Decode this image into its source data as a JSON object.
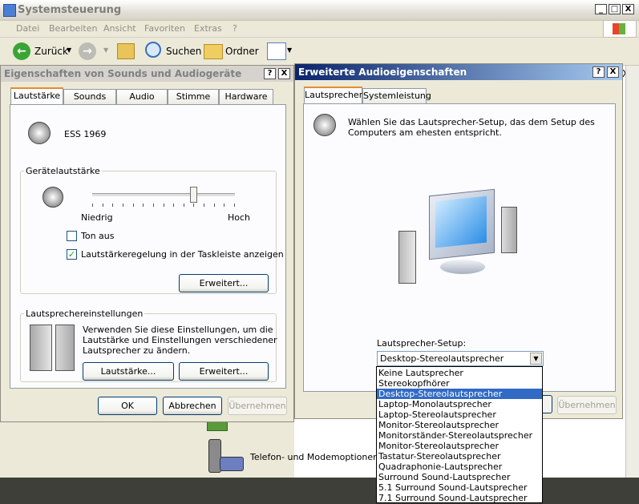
{
  "explorer": {
    "title": "Systemsteuerung",
    "menu": [
      "Datei",
      "Bearbeiten",
      "Ansicht",
      "Favoriten",
      "Extras",
      "?"
    ],
    "toolbar": {
      "back": "Zurück",
      "search": "Suchen",
      "folders": "Ordner"
    },
    "item_phone_modem": "Telefon- und Modemoptionen",
    "caption_buttons": {
      "minimize": "_",
      "maximize": "□",
      "close": "X"
    }
  },
  "sound_dialog": {
    "title": "Eigenschaften von Sounds und Audiogeräte",
    "help": "?",
    "close": "X",
    "tabs": [
      "Lautstärke",
      "Sounds",
      "Audio",
      "Stimme",
      "Hardware"
    ],
    "device_name": "ESS 1969",
    "volume_group": "Gerätelautstärke",
    "volume_low": "Niedrig",
    "volume_high": "Hoch",
    "volume_level": 0.72,
    "mute_label": "Ton aus",
    "mute_checked": false,
    "taskbar_label": "Lautstärkeregelung in der Taskleiste anzeigen",
    "taskbar_checked": true,
    "advanced_button": "Erweitert...",
    "speaker_group": "Lautsprechereinstellungen",
    "speaker_text": [
      "Verwenden Sie diese Einstellungen, um die",
      "Lautstärke und Einstellungen verschiedener",
      "Lautsprecher zu ändern."
    ],
    "speaker_volume_button": "Lautstärke...",
    "speaker_advanced_button": "Erweitert...",
    "ok": "OK",
    "cancel": "Abbrechen",
    "apply": "Übernehmen"
  },
  "advanced_dialog": {
    "title": "Erweiterte Audioeigenschaften",
    "help": "?",
    "close": "X",
    "tabs": [
      "Lautsprecher",
      "Systemleistung"
    ],
    "intro": [
      "Wählen Sie das Lautsprecher-Setup, das dem Setup des",
      "Computers am ehesten entspricht."
    ],
    "setup_label": "Lautsprecher-Setup:",
    "setup_selected": "Desktop-Stereolautsprecher",
    "setup_options": [
      "Keine Lautsprecher",
      "Stereokopfhörer",
      "Desktop-Stereolautsprecher",
      "Laptop-Monolautsprecher",
      "Laptop-Stereolautsprecher",
      "Monitor-Stereolautsprecher",
      "Monitorständer-Stereolautsprecher",
      "Monitor-Stereolautsprecher",
      "Tastatur-Stereolautsprecher",
      "Quadraphonie-Lautsprecher",
      "Surround Sound-Lautsprecher",
      "5.1 Surround Sound-Lautsprecher",
      "7.1 Surround Sound-Lautsprecher"
    ],
    "selected_index": 2,
    "apply": "Übernehmen"
  },
  "colors": {
    "title_active": "#0a246a",
    "title_inactive": "#d6d3ce",
    "selection": "#316ac5"
  }
}
